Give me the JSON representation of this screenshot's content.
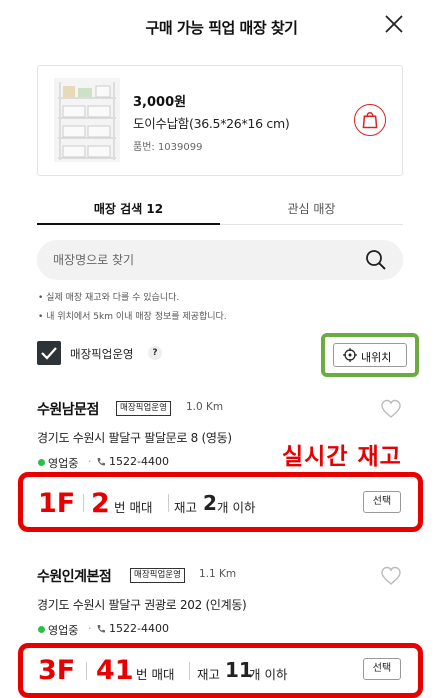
{
  "header": {
    "title": "구매 가능 픽업 매장 찾기"
  },
  "product": {
    "price": "3,000원",
    "name": "도이수납함(36.5*26*16 cm)",
    "code": "품번: 1039099"
  },
  "tabs": [
    {
      "label": "매장 검색 12",
      "active": true
    },
    {
      "label": "관심 매장",
      "active": false
    }
  ],
  "search": {
    "placeholder": "매장명으로 찾기"
  },
  "notes": [
    "실제 매장 재고와 다를 수 있습니다.",
    "내 위치에서 5km 이내 매장 정보를 제공합니다."
  ],
  "filter": {
    "label": "매장픽업운영",
    "checked": true,
    "help": "?"
  },
  "my_location": {
    "label": "내위치"
  },
  "annotation": {
    "realtime": "실시간 재고"
  },
  "stores": [
    {
      "name": "수원남문점",
      "tag": "매장픽업운영",
      "distance": "1.0 Km",
      "address": "경기도 수원시 팔달구 팔달문로 8 (영동)",
      "status": "영업중",
      "phone": "1522-4400",
      "floor": "1F",
      "shelf": "2",
      "shelf_unit": "번 매대",
      "stock_label": "재고",
      "stock": "2",
      "stock_unit": "개 이하",
      "select_label": "선택"
    },
    {
      "name": "수원인계본점",
      "tag": "매장픽업운영",
      "distance": "1.1 Km",
      "address": "경기도 수원시 팔달구 권광로 202 (인계동)",
      "status": "영업중",
      "phone": "1522-4400",
      "floor": "3F",
      "shelf": "41",
      "shelf_unit": "번 매대",
      "stock_label": "재고",
      "stock": "11",
      "stock_unit": "개 이하",
      "select_label": "선택"
    }
  ],
  "colors": {
    "accent_red": "#e80000",
    "highlight_green": "#6cab40",
    "status_green": "#2bbf4a"
  }
}
